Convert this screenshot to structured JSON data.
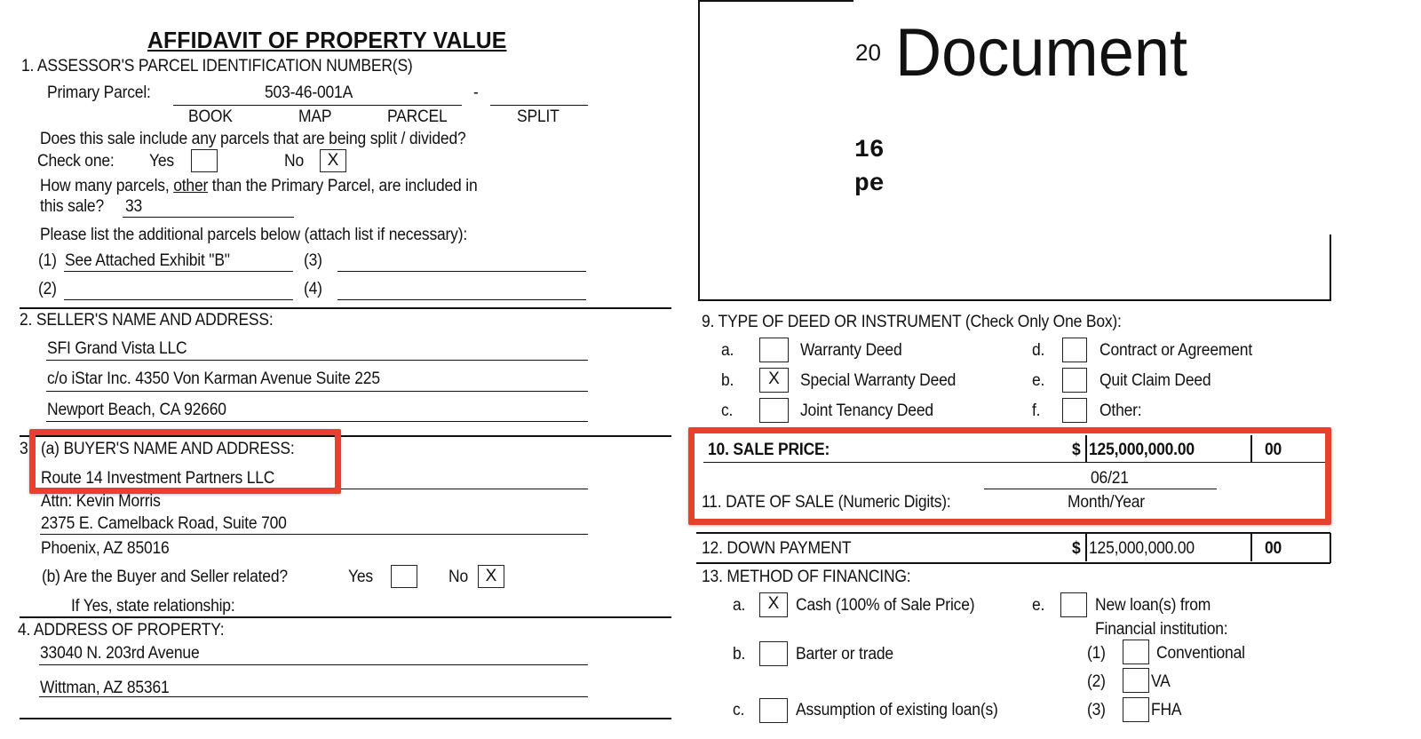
{
  "left": {
    "title": "AFFIDAVIT OF PROPERTY VALUE",
    "s1": {
      "heading": "1. ASSESSOR'S PARCEL IDENTIFICATION NUMBER(S)",
      "primary_label": "Primary Parcel:",
      "primary_value": "503-46-001A",
      "dash": "-",
      "col_labels": [
        "BOOK",
        "MAP",
        "PARCEL",
        "SPLIT"
      ],
      "split_question": "Does this sale include any parcels that are being split / divided?",
      "check_one": "Check one:",
      "yes": "Yes",
      "no": "No",
      "split_yes": "",
      "split_no": "X",
      "how_many_q1": "How many parcels, ",
      "how_many_other": "other",
      "how_many_q2": " than the Primary Parcel, are included in",
      "how_many_q3": "this sale?",
      "how_many_value": "33",
      "list_prompt": "Please list the additional parcels below (attach list if necessary):",
      "parcels": [
        {
          "num": "(1)",
          "value": "See Attached Exhibit \"B\""
        },
        {
          "num": "(2)",
          "value": ""
        },
        {
          "num": "(3)",
          "value": ""
        },
        {
          "num": "(4)",
          "value": ""
        }
      ]
    },
    "s2": {
      "heading": "2. SELLER'S NAME AND ADDRESS:",
      "lines": [
        "SFI Grand Vista LLC",
        "c/o iStar Inc. 4350 Von Karman Avenue Suite 225",
        "Newport Beach, CA 92660"
      ]
    },
    "s3": {
      "num": "3",
      "heading": "(a) BUYER'S NAME AND ADDRESS:",
      "lines": [
        "Route 14 Investment Partners LLC",
        "Attn: Kevin Morris",
        "2375 E. Camelback Road, Suite 700",
        "Phoenix, AZ 85016"
      ],
      "related_q": "(b) Are the Buyer and Seller related?",
      "yes": "Yes",
      "no": "No",
      "related_yes": "",
      "related_no": "X",
      "relationship_label": "If Yes, state relationship:"
    },
    "s4": {
      "heading": "4. ADDRESS OF PROPERTY:",
      "lines": [
        "33040 N. 203rd Avenue",
        "Wittman, AZ 85361"
      ]
    }
  },
  "right": {
    "stamp": {
      "small_prefix": "20",
      "big": "Document",
      "line1": "16",
      "line2": "pe"
    },
    "s9": {
      "heading": "9. TYPE OF DEED OR INSTRUMENT (Check Only One Box):",
      "options": [
        {
          "letter": "a.",
          "label": "Warranty Deed",
          "mark": ""
        },
        {
          "letter": "b.",
          "label": "Special Warranty Deed",
          "mark": "X"
        },
        {
          "letter": "c.",
          "label": "Joint Tenancy Deed",
          "mark": ""
        },
        {
          "letter": "d.",
          "label": "Contract or Agreement",
          "mark": ""
        },
        {
          "letter": "e.",
          "label": "Quit Claim Deed",
          "mark": ""
        },
        {
          "letter": "f.",
          "label": "Other:",
          "mark": ""
        }
      ]
    },
    "s10": {
      "label": "10. SALE PRICE:",
      "currency": "$",
      "value": "125,000,000.00",
      "cents": "00"
    },
    "s11": {
      "label": "11. DATE OF SALE (Numeric Digits):",
      "value": "06/21",
      "sublabel": "Month/Year"
    },
    "s12": {
      "label": "12. DOWN PAYMENT",
      "currency": "$",
      "value": "125,000,000.00",
      "cents": "00"
    },
    "s13": {
      "heading": "13. METHOD OF FINANCING:",
      "options": [
        {
          "letter": "a.",
          "label": "Cash (100% of Sale Price)",
          "mark": "X"
        },
        {
          "letter": "b.",
          "label": "Barter or trade",
          "mark": ""
        },
        {
          "letter": "c.",
          "label": "Assumption of existing loan(s)",
          "mark": ""
        },
        {
          "letter": "e.",
          "label": "New loan(s) from",
          "mark": ""
        }
      ],
      "institution_label": "Financial institution:",
      "loan_types": [
        {
          "num": "(1)",
          "label": "Conventional",
          "mark": ""
        },
        {
          "num": "(2)",
          "label": "VA",
          "mark": ""
        },
        {
          "num": "(3)",
          "label": "FHA",
          "mark": ""
        }
      ]
    }
  },
  "highlight_color": "#e8402d"
}
